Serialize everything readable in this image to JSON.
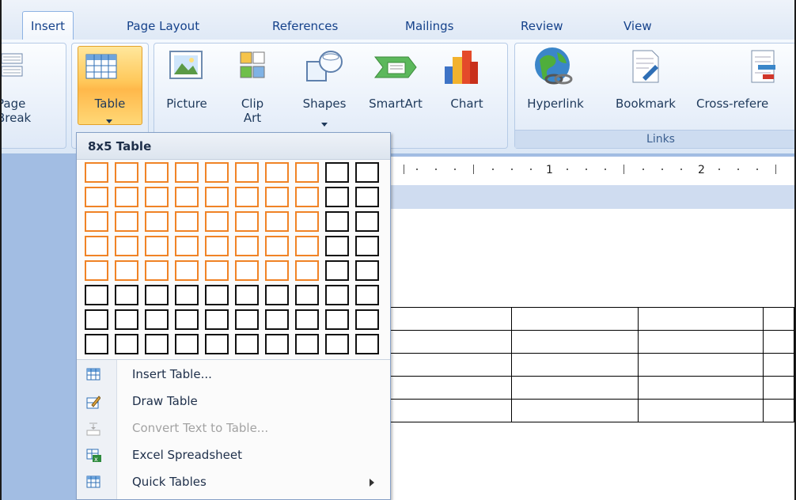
{
  "tabs": {
    "insert": "Insert",
    "page_layout": "Page Layout",
    "references": "References",
    "mailings": "Mailings",
    "review": "Review",
    "view": "View"
  },
  "ribbon": {
    "page_break": {
      "line1": "Page",
      "line2": "Break"
    },
    "table": "Table",
    "picture": "Picture",
    "clip_art": {
      "line1": "Clip",
      "line2": "Art"
    },
    "shapes": "Shapes",
    "smartart": "SmartArt",
    "chart": "Chart",
    "hyperlink": "Hyperlink",
    "bookmark": "Bookmark",
    "cross_reference": "Cross-refere",
    "links_group": "Links"
  },
  "ruler": {
    "num1": "1",
    "num2": "2"
  },
  "menu": {
    "title": "8x5 Table",
    "grid": {
      "columns": 10,
      "rows": 8,
      "selected_columns": 8,
      "selected_rows": 5
    },
    "items": [
      {
        "label": "Insert Table...",
        "icon": "insert-table-icon",
        "enabled": true
      },
      {
        "label": "Draw Table",
        "icon": "draw-table-icon",
        "enabled": true
      },
      {
        "label": "Convert Text to Table...",
        "icon": "convert-text-icon",
        "enabled": false
      },
      {
        "label": "Excel Spreadsheet",
        "icon": "excel-spreadsheet-icon",
        "enabled": true
      },
      {
        "label": "Quick Tables",
        "icon": "quick-tables-icon",
        "enabled": true
      }
    ]
  },
  "colors": {
    "accent_selected": "#f08326",
    "ribbon_text": "#1e395b",
    "doc_background": "#a2bde3"
  }
}
